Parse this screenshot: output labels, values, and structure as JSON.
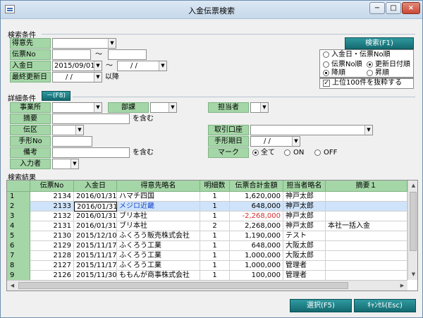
{
  "window": {
    "title": "入金伝票検索",
    "min": "−",
    "max": "□",
    "close": "×"
  },
  "search_conditions": {
    "section_label": "検索条件",
    "tokuisaki_label": "得意先",
    "denpyo_no_label": "伝票No",
    "nyukin_bi_label": "入金日",
    "nyukin_bi_from": "2015/09/01",
    "nyukin_bi_to": "/ /",
    "saishu_label": "最終更新日",
    "saishu_from": "/ /",
    "tilde": "～",
    "ikou": "以降",
    "search_button": "検索(F1)",
    "sort_options": [
      "入金日・伝票No順",
      "更新日付順",
      "伝票No順"
    ],
    "order_options": [
      "降順",
      "昇順"
    ],
    "top100_label": "上位100件を抜粋する",
    "check_mark": "✓"
  },
  "detail_conditions": {
    "section_label": "詳細条件",
    "toggle_button": "－(F8)",
    "jigyosho_label": "事業所",
    "bumon_label": "部課",
    "tantosha_label": "担当者",
    "tekiyo_label": "摘要",
    "wo_fukumu": "を含む",
    "denku_label": "伝区",
    "torihiki_label": "取引口座",
    "tegata_no_label": "手形No",
    "tegata_kijitsu_label": "手形期日",
    "tegata_kijitsu_value": "/ /",
    "biko_label": "備考",
    "mark_label": "マーク",
    "mark_options": [
      "全て",
      "ON",
      "OFF"
    ],
    "nyuryokusha_label": "入力者"
  },
  "results": {
    "section_label": "検索結果",
    "columns": [
      "伝票No",
      "入金日",
      "得意先略名",
      "明細数",
      "伝票合計金額",
      "担当者略名",
      "摘要１"
    ],
    "rows": [
      {
        "no": "1",
        "denpyo": "2134",
        "date": "2016/01/31",
        "customer": "ハマチ四国",
        "count": "1",
        "amount": "1,620,000",
        "tanto": "神戸太郎",
        "tekiyo": ""
      },
      {
        "no": "2",
        "denpyo": "2133",
        "date": "2016/01/31",
        "customer": "メジロ近畿",
        "count": "1",
        "amount": "648,000",
        "tanto": "神戸太郎",
        "tekiyo": ""
      },
      {
        "no": "3",
        "denpyo": "2132",
        "date": "2016/01/31",
        "customer": "ブリ本社",
        "count": "1",
        "amount": "-2,268,000",
        "tanto": "神戸太郎",
        "tekiyo": ""
      },
      {
        "no": "4",
        "denpyo": "2131",
        "date": "2016/01/31",
        "customer": "ブリ本社",
        "count": "2",
        "amount": "2,268,000",
        "tanto": "神戸太郎",
        "tekiyo": "本社一括入金"
      },
      {
        "no": "5",
        "denpyo": "2130",
        "date": "2015/12/10",
        "customer": "ふくろう販売株式会社",
        "count": "1",
        "amount": "1,190,000",
        "tanto": "テスト",
        "tekiyo": ""
      },
      {
        "no": "6",
        "denpyo": "2129",
        "date": "2015/11/17",
        "customer": "ふくろう工業",
        "count": "1",
        "amount": "648,000",
        "tanto": "大阪太郎",
        "tekiyo": ""
      },
      {
        "no": "7",
        "denpyo": "2128",
        "date": "2015/11/17",
        "customer": "ふくろう工業",
        "count": "1",
        "amount": "1,000,000",
        "tanto": "大阪太郎",
        "tekiyo": ""
      },
      {
        "no": "8",
        "denpyo": "2127",
        "date": "2015/11/17",
        "customer": "ふくろう工業",
        "count": "1",
        "amount": "1,000,000",
        "tanto": "管理者",
        "tekiyo": ""
      },
      {
        "no": "9",
        "denpyo": "2126",
        "date": "2015/11/30",
        "customer": "ももんが商事株式会社",
        "count": "1",
        "amount": "100,000",
        "tanto": "管理者",
        "tekiyo": ""
      }
    ]
  },
  "footer": {
    "select_button": "選択(F5)",
    "cancel_button": "ｷｬﾝｾﾙ(Esc)"
  },
  "colors": {
    "label_bg": "#a5d6a7",
    "button_teal": "#136a70",
    "negative": "#d32f2f",
    "selected_row": "#cfe3fa"
  },
  "icons": [
    "app-icon",
    "dropdown-arrow-icon",
    "scroll-up-icon",
    "scroll-down-icon",
    "scroll-left-icon",
    "scroll-right-icon"
  ]
}
